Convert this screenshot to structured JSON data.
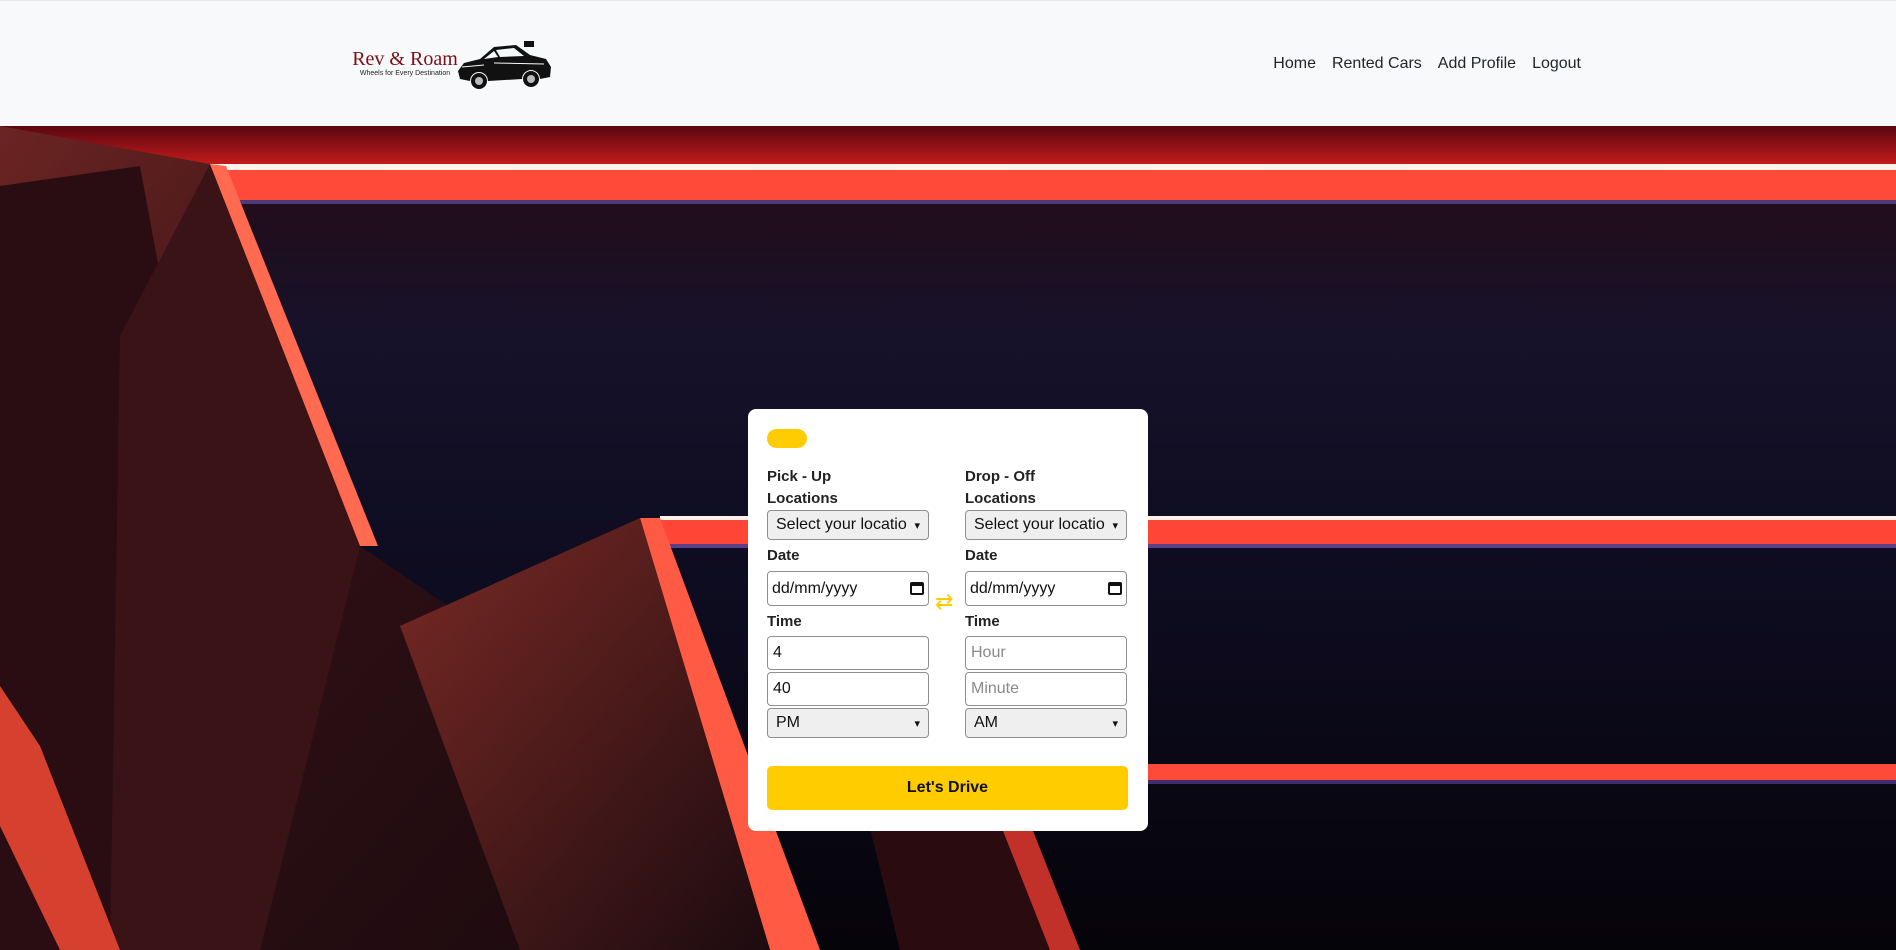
{
  "brand": {
    "name": "Rev & Roam",
    "tagline": "Wheels for Every Destination",
    "logo_icon": "muscle-car-icon"
  },
  "nav": {
    "items": [
      {
        "label": "Home"
      },
      {
        "label": "Rented Cars"
      },
      {
        "label": "Add Profile"
      },
      {
        "label": "Logout"
      }
    ]
  },
  "booking": {
    "pickup": {
      "heading": "Pick - Up Locations",
      "location_value": "Select your locatio",
      "date_label": "Date",
      "date_placeholder": "dd/mm/yyyy",
      "time_label": "Time",
      "hour_value": "4",
      "minute_value": "40",
      "ampm_value": "PM"
    },
    "dropoff": {
      "heading": "Drop - Off Locations",
      "location_value": "Select your locatio",
      "date_label": "Date",
      "date_placeholder": "dd/mm/yyyy",
      "time_label": "Time",
      "hour_placeholder": "Hour",
      "minute_placeholder": "Minute",
      "ampm_value": "AM"
    },
    "swap_icon": "swap-arrows-icon",
    "submit_label": "Let's Drive"
  },
  "colors": {
    "accent": "#ffcc00",
    "brand_red": "#7a1016",
    "header_bg": "#f8f9fa"
  }
}
